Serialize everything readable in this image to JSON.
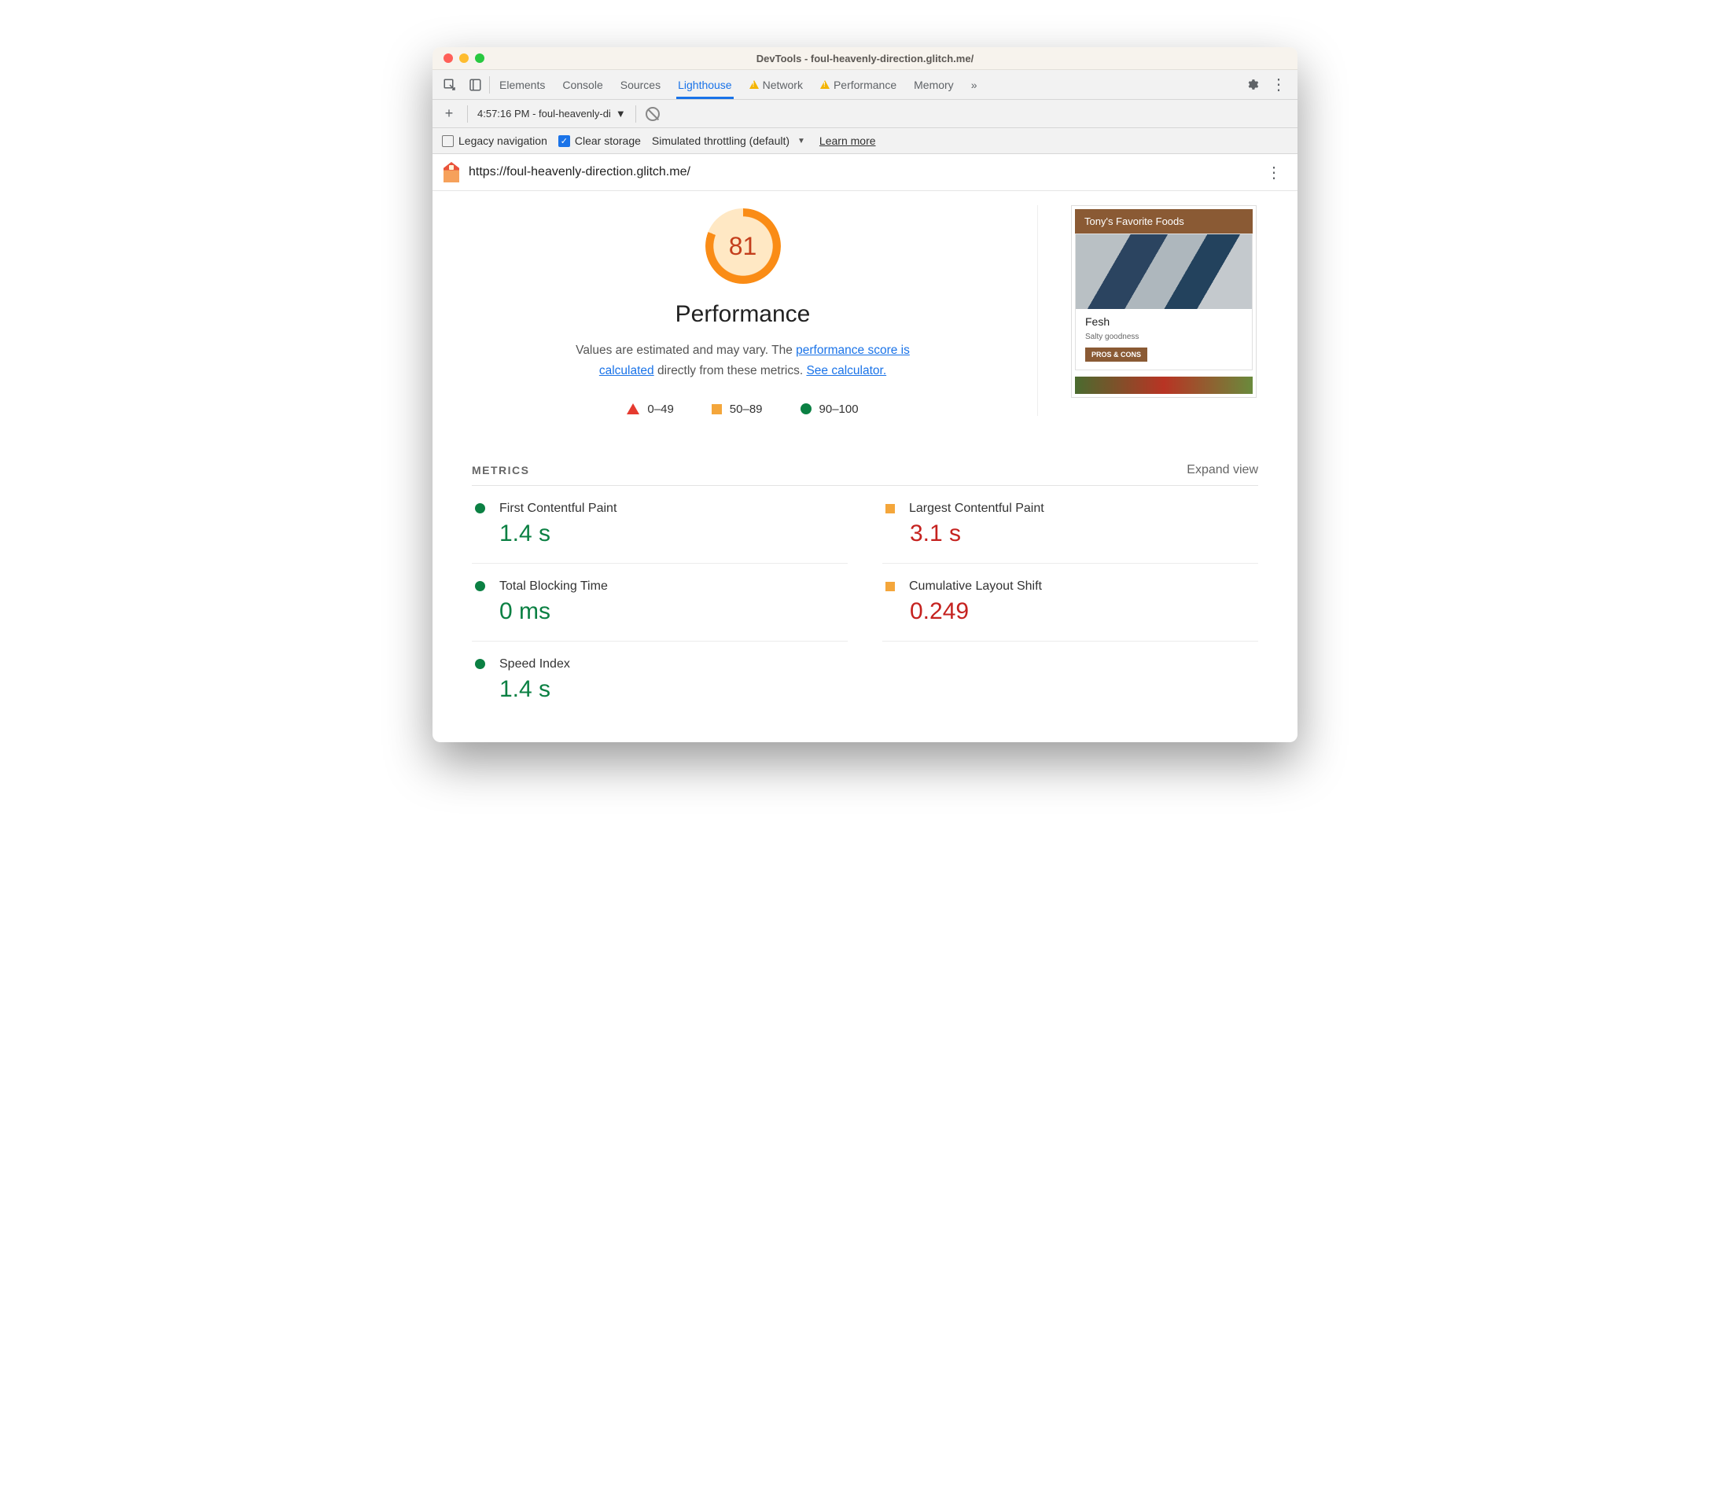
{
  "titlebar": {
    "title": "DevTools - foul-heavenly-direction.glitch.me/"
  },
  "tabs": {
    "elements": "Elements",
    "console": "Console",
    "sources": "Sources",
    "lighthouse": "Lighthouse",
    "network": "Network",
    "performance": "Performance",
    "memory": "Memory"
  },
  "subrow": {
    "report": "4:57:16 PM - foul-heavenly-di"
  },
  "options": {
    "legacy": "Legacy navigation",
    "clear": "Clear storage",
    "throttle": "Simulated throttling (default)",
    "learn": "Learn more"
  },
  "address": {
    "url": "https://foul-heavenly-direction.glitch.me/"
  },
  "gauge": {
    "score": "81",
    "title": "Performance",
    "desc1": "Values are estimated and may vary. The ",
    "link1": "performance score is calculated",
    "desc2": " directly from these metrics. ",
    "link2": "See calculator."
  },
  "legend": {
    "r": "0–49",
    "o": "50–89",
    "g": "90–100"
  },
  "thumb": {
    "header": "Tony's Favorite Foods",
    "cardTitle": "Fesh",
    "cardSub": "Salty goodness",
    "btn": "PROS & CONS"
  },
  "metrics": {
    "title": "METRICS",
    "expand": "Expand view",
    "items": [
      {
        "label": "First Contentful Paint",
        "value": "1.4 s",
        "status": "pass"
      },
      {
        "label": "Largest Contentful Paint",
        "value": "3.1 s",
        "status": "avg"
      },
      {
        "label": "Total Blocking Time",
        "value": "0 ms",
        "status": "pass"
      },
      {
        "label": "Cumulative Layout Shift",
        "value": "0.249",
        "status": "avg"
      },
      {
        "label": "Speed Index",
        "value": "1.4 s",
        "status": "pass"
      }
    ]
  }
}
